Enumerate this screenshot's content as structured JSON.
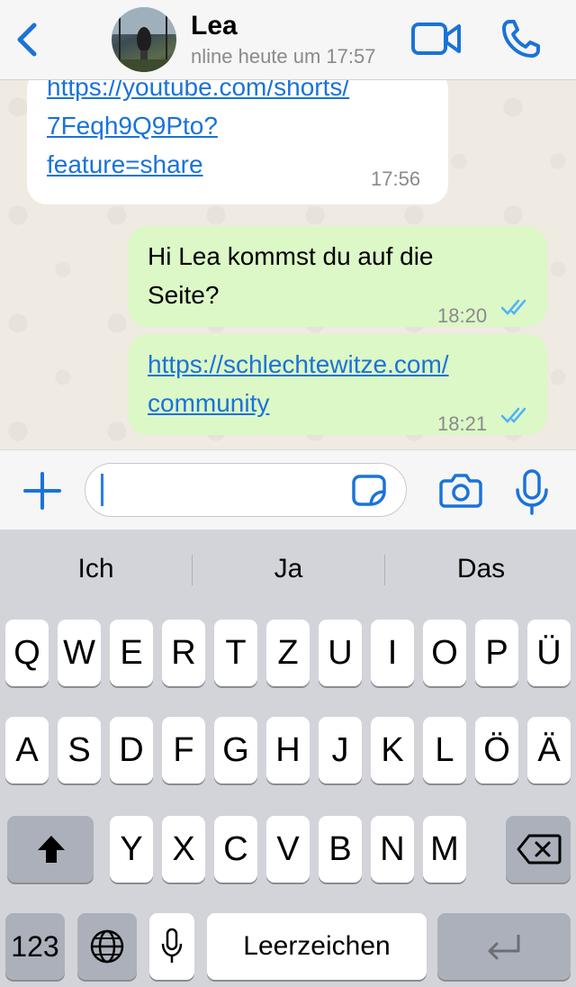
{
  "header": {
    "contact_name": "Lea",
    "status": "nline heute um 17:57"
  },
  "messages": [
    {
      "direction": "incoming",
      "lines": [
        "https://youtube.com/shorts/",
        "7Feqh9Q9Pto?",
        "feature=share"
      ],
      "is_link": true,
      "time": "17:56"
    },
    {
      "direction": "outgoing",
      "lines": [
        "Hi Lea kommst du auf die",
        "Seite?"
      ],
      "is_link": false,
      "time": "18:20",
      "read": true
    },
    {
      "direction": "outgoing",
      "lines": [
        "https://schlechtewitze.com/",
        "community"
      ],
      "is_link": true,
      "time": "18:21",
      "read": true
    }
  ],
  "input": {
    "value": ""
  },
  "keyboard": {
    "suggestions": [
      "Ich",
      "Ja",
      "Das"
    ],
    "row1": [
      "Q",
      "W",
      "E",
      "R",
      "T",
      "Z",
      "U",
      "I",
      "O",
      "P",
      "Ü"
    ],
    "row2": [
      "A",
      "S",
      "D",
      "F",
      "G",
      "H",
      "J",
      "K",
      "L",
      "Ö",
      "Ä"
    ],
    "row3": [
      "Y",
      "X",
      "C",
      "V",
      "B",
      "N",
      "M"
    ],
    "numbers_label": "123",
    "space_label": "Leerzeichen"
  },
  "colors": {
    "accent": "#1a73d9",
    "outgoing_bubble": "#dcf8c6",
    "incoming_bubble": "#ffffff",
    "read_ticks": "#4fb3f6"
  },
  "icons": [
    "back-chevron-icon",
    "video-call-icon",
    "phone-icon",
    "plus-icon",
    "sticker-icon",
    "camera-icon",
    "microphone-icon",
    "shift-icon",
    "backspace-icon",
    "globe-icon",
    "keyboard-mic-icon",
    "return-icon",
    "double-check-icon"
  ]
}
